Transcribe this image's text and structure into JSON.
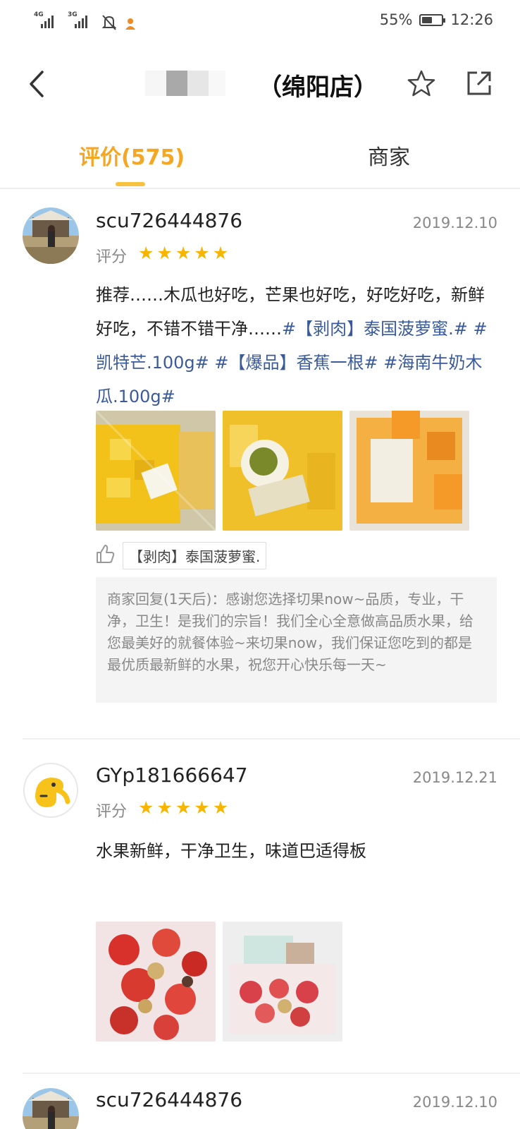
{
  "status_bar": {
    "net1": "4G",
    "net2": "3G",
    "battery_percent": "55%",
    "battery_level": 0.55,
    "time": "12:26"
  },
  "header": {
    "title": "（绵阳店）",
    "icons": [
      "back-arrow-icon",
      "star-outline-icon",
      "share-external-icon"
    ]
  },
  "tabs": {
    "review": "评价(575)",
    "merchant": "商家"
  },
  "colors": {
    "accent": "#f5a623",
    "star": "#f7b500",
    "tag_link": "#3a5a9a"
  },
  "reviews": [
    {
      "username": "scu726444876",
      "date": "2019.12.10",
      "rating_label": "评分",
      "rating": 5,
      "text_plain": "推荐……木瓜也好吃，芒果也好吃，好吃好吃，新鲜好吃，不错不错干净……",
      "text_tags": "#【剥肉】泰国菠萝蜜.# #凯特芒.100g# #【爆品】香蕉一根# #海南牛奶木瓜.100g#",
      "dish_tag": "【剥肉】泰国菠萝蜜.",
      "reply": "商家回复(1天后)：感谢您选择切果now~品质，专业，干净，卫生！是我们的宗旨！我们全心全意做高品质水果，给您最美好的就餐体验~来切果now，我们保证您吃到的都是最优质最新鲜的水果，祝您开心快乐每一天~"
    },
    {
      "username": "GYp181666647",
      "date": "2019.12.21",
      "rating_label": "评分",
      "rating": 5,
      "text_plain": "水果新鲜，干净卫生，味道巴适得板"
    },
    {
      "username": "scu726444876",
      "date": "2019.12.10"
    }
  ]
}
